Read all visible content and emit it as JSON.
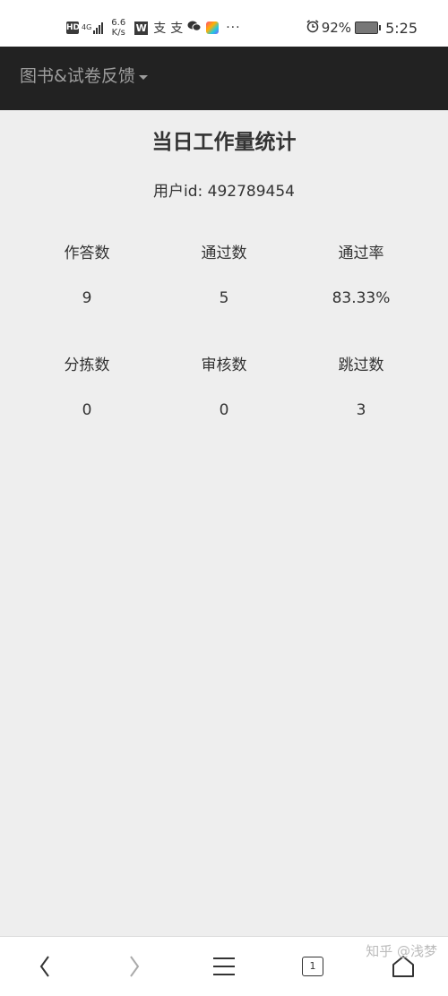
{
  "status_bar": {
    "hd": "HD",
    "network": "4G",
    "speed_value": "6.6",
    "speed_unit": "K/s",
    "wps": "W",
    "app_glyphs": [
      "支",
      "支"
    ],
    "more": "···",
    "battery_percent": "92%",
    "time": "5:25"
  },
  "navbar": {
    "brand": "图书&试卷反馈"
  },
  "page": {
    "title": "当日工作量统计",
    "user_line": "用户id: 492789454"
  },
  "stats": [
    {
      "label": "作答数",
      "value": "9"
    },
    {
      "label": "通过数",
      "value": "5"
    },
    {
      "label": "通过率",
      "value": "83.33%"
    },
    {
      "label": "分拣数",
      "value": "0"
    },
    {
      "label": "审核数",
      "value": "0"
    },
    {
      "label": "跳过数",
      "value": "3"
    }
  ],
  "bottom_bar": {
    "tab_count": "1"
  },
  "watermark": "知乎 @浅梦",
  "colors": {
    "navbar_bg": "#222222",
    "navbar_text": "#9d9d9d",
    "page_bg": "#eeeeee"
  }
}
